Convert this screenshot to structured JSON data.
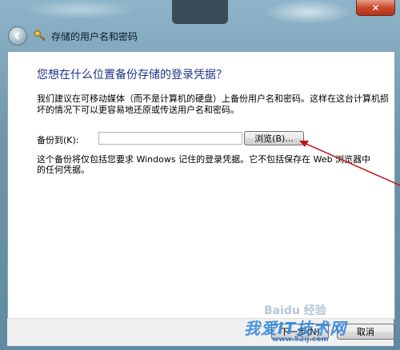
{
  "window": {
    "title": "存储的用户名和密码",
    "close_label": "✕"
  },
  "content": {
    "heading": "您想在什么位置备份存储的登录凭据？",
    "paragraph": "我们建议在可移动媒体（而不是计算机的硬盘）上备份用户名和密码。这样在这台计算机损坏的情况下可以更容易地还原或传送用户名和密码。",
    "backup_label": "备份到(K):",
    "path_value": "",
    "browse_label": "浏览(B)...",
    "note": "这个备份将仅包括您要求 Windows 记住的登录凭据。它不包括保存在 Web 浏览器中的任何凭据。"
  },
  "buttons": {
    "next_label": "下一步(N)",
    "cancel_label": "取消"
  },
  "watermark": {
    "baidu": "Baidu 经验",
    "site": "我爱IT技术网",
    "url": "www.52ij.com"
  },
  "colors": {
    "heading": "#1e3287",
    "arrow": "#c0121a"
  }
}
